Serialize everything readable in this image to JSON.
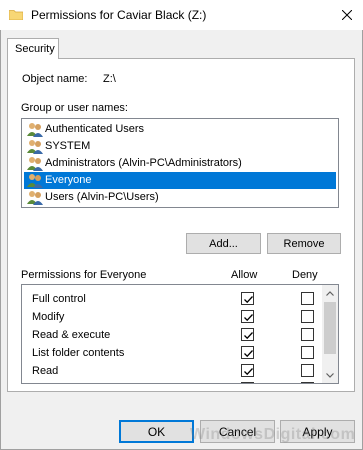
{
  "window": {
    "title": "Permissions for Caviar Black (Z:)",
    "icon": "folder-icon"
  },
  "tabs": [
    {
      "label": "Security",
      "active": true
    }
  ],
  "object": {
    "label": "Object name:",
    "value": "Z:\\"
  },
  "groups": {
    "label": "Group or user names:",
    "items": [
      {
        "label": "Authenticated Users",
        "selected": false
      },
      {
        "label": "SYSTEM",
        "selected": false
      },
      {
        "label": "Administrators (Alvin-PC\\Administrators)",
        "selected": false
      },
      {
        "label": "Everyone",
        "selected": true
      },
      {
        "label": "Users (Alvin-PC\\Users)",
        "selected": false
      }
    ],
    "add_label": "Add...",
    "remove_label": "Remove"
  },
  "permissions": {
    "header": "Permissions for Everyone",
    "allow_label": "Allow",
    "deny_label": "Deny",
    "rows": [
      {
        "label": "Full control",
        "allow": true,
        "deny": false
      },
      {
        "label": "Modify",
        "allow": true,
        "deny": false
      },
      {
        "label": "Read & execute",
        "allow": true,
        "deny": false
      },
      {
        "label": "List folder contents",
        "allow": true,
        "deny": false
      },
      {
        "label": "Read",
        "allow": true,
        "deny": false
      }
    ]
  },
  "footer": {
    "ok_label": "OK",
    "cancel_label": "Cancel",
    "apply_label": "Apply"
  },
  "watermark": "WindowsDigital.com",
  "colors": {
    "selection": "#0078d7",
    "default_button_border": "#0078d7"
  }
}
